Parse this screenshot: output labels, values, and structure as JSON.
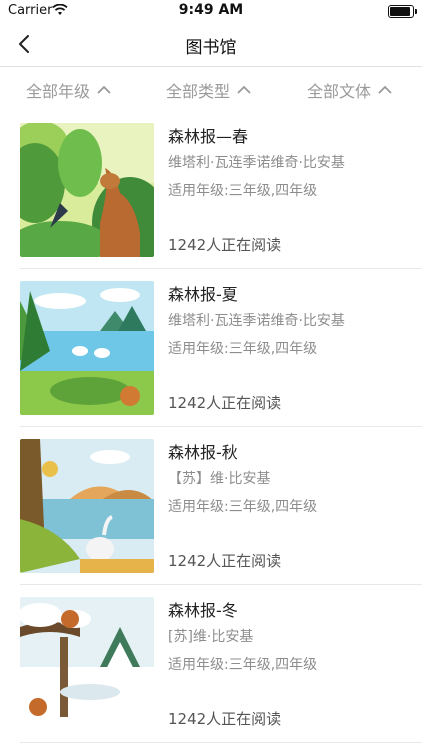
{
  "status_bar": {
    "carrier": "Carrier",
    "time": "9:49 AM"
  },
  "navbar": {
    "title": "图书馆"
  },
  "filters": [
    {
      "label": "全部年级"
    },
    {
      "label": "全部类型"
    },
    {
      "label": "全部文体"
    }
  ],
  "books": [
    {
      "title": "森林报—春",
      "author": "维塔利·瓦连季诺维奇·比安基",
      "grade": "适用年级:三年级,四年级",
      "readers": "1242人正在阅读",
      "season": "spring"
    },
    {
      "title": "森林报-夏",
      "author": "维塔利·瓦连季诺维奇·比安基",
      "grade": "适用年级:三年级,四年级",
      "readers": "1242人正在阅读",
      "season": "summer"
    },
    {
      "title": "森林报-秋",
      "author": "【苏】维·比安基",
      "grade": "适用年级:三年级,四年级",
      "readers": "1242人正在阅读",
      "season": "autumn"
    },
    {
      "title": "森林报-冬",
      "author": "[苏]维·比安基",
      "grade": "适用年级:三年级,四年级",
      "readers": "1242人正在阅读",
      "season": "winter"
    }
  ]
}
